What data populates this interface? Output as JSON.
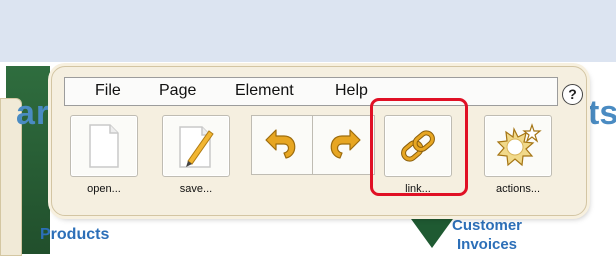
{
  "menu": {
    "file": "File",
    "page": "Page",
    "element": "Element",
    "help": "Help",
    "help_button": "?"
  },
  "toolbar": {
    "open_label": "open...",
    "save_label": "save...",
    "link_label": "link...",
    "actions_label": "actions..."
  },
  "background": {
    "cut_left": "ar",
    "cut_right": "ts",
    "products": "Products",
    "customer_line1": "Customer",
    "customer_line2": "Invoices"
  },
  "colors": {
    "highlight": "#e01025",
    "link_text": "#2c6fb8",
    "icon_gold": "#e7a622"
  }
}
